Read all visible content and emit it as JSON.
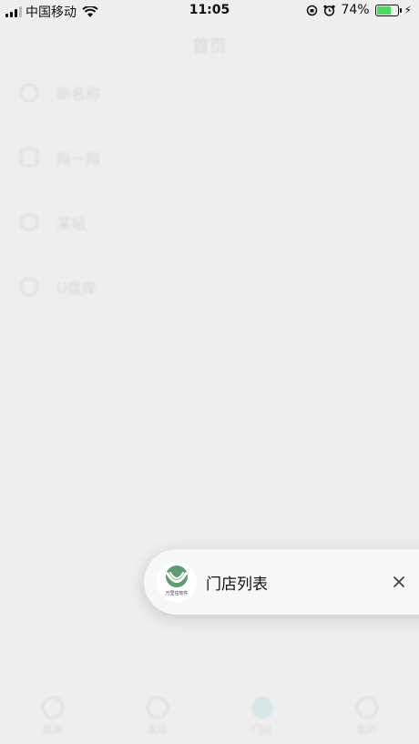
{
  "status_bar": {
    "carrier": "中国移动",
    "time": "11:05",
    "battery_percent": "74%",
    "battery_level": 0.74,
    "battery_color": "#4cd964"
  },
  "background": {
    "title": "首页",
    "menu": [
      {
        "label": "新名称",
        "icon": "circle-icon"
      },
      {
        "label": "拟一拟",
        "icon": "chat-icon"
      },
      {
        "label": "某站",
        "icon": "location-icon"
      },
      {
        "label": "U盘库",
        "icon": "refresh-icon"
      }
    ],
    "tabs": [
      {
        "label": "首页",
        "icon": "home-icon"
      },
      {
        "label": "发现",
        "icon": "discover-icon"
      },
      {
        "label": "门店",
        "icon": "store-icon",
        "active": true
      },
      {
        "label": "我的",
        "icon": "user-icon"
      }
    ]
  },
  "float_card": {
    "logo_caption": "万里信软件",
    "title": "门店列表",
    "close_icon": "close-icon"
  }
}
